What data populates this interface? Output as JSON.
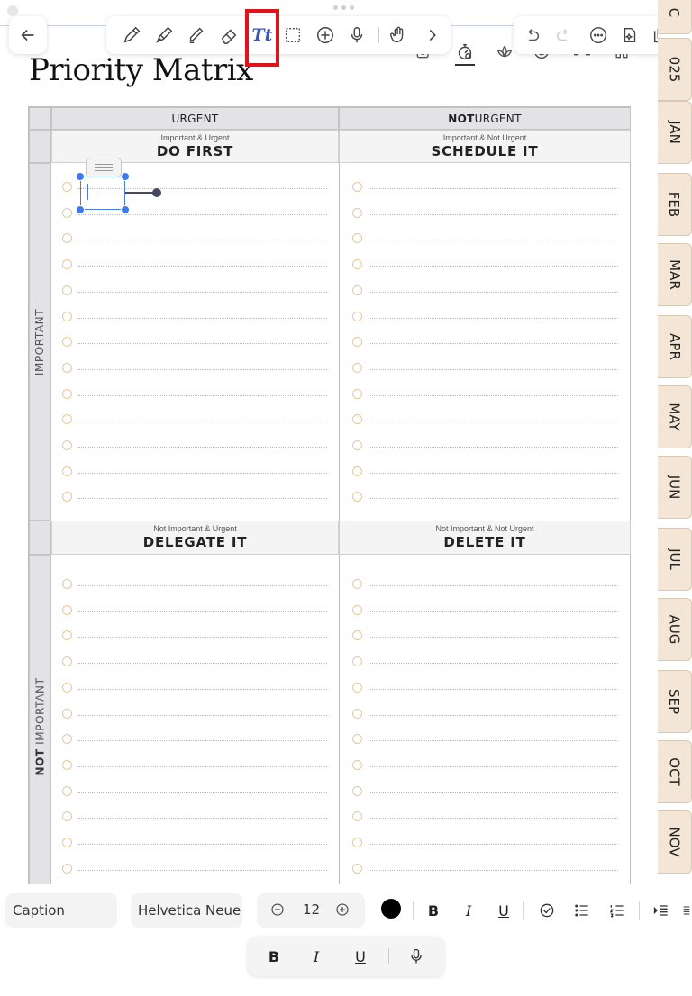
{
  "page": {
    "title": "Priority Matrix"
  },
  "toolbar": {
    "tools": [
      "back",
      "pen",
      "highlighter",
      "marker",
      "eraser",
      "text",
      "lasso",
      "add",
      "microphone",
      "hand",
      "more"
    ],
    "active_tool_label": "Tt",
    "right_tools": [
      "undo",
      "redo",
      "more-options",
      "shape-sparkle",
      "copy-pages"
    ]
  },
  "page_icons": [
    "note-edit",
    "stopwatch",
    "lotus",
    "target",
    "dumbbell",
    "home"
  ],
  "matrix": {
    "col_headers": [
      {
        "prefix": "",
        "text": "URGENT"
      },
      {
        "prefix": "NOT",
        "text": " URGENT"
      }
    ],
    "row_headers": [
      {
        "prefix": "",
        "text": "IMPORTANT"
      },
      {
        "prefix": "NOT",
        "text": " IMPORTANT"
      }
    ],
    "quadrants": [
      {
        "sub": "Important & Urgent",
        "title": "DO FIRST"
      },
      {
        "sub": "Important & Not Urgent",
        "title": "SCHEDULE IT"
      },
      {
        "sub": "Not Important & Urgent",
        "title": "DELEGATE IT"
      },
      {
        "sub": "Not Important & Not Urgent",
        "title": "DELETE IT"
      }
    ]
  },
  "side_tabs": [
    "C",
    "025",
    "JAN",
    "FEB",
    "MAR",
    "APR",
    "MAY",
    "JUN",
    "JUL",
    "AUG",
    "SEP",
    "OCT",
    "NOV"
  ],
  "text_toolbar": {
    "style": "Caption",
    "font": "Helvetica Neue",
    "size": "12",
    "color": "#000000",
    "bold": "B",
    "italic": "I",
    "underline": "U"
  },
  "floating_toolbar": {
    "bold": "B",
    "italic": "I",
    "underline": "U"
  },
  "colors": {
    "highlight": "#e1121b",
    "accent": "#3f7be8",
    "tab_fill": "#f4e6d6",
    "checkbox": "#e7c89a"
  }
}
